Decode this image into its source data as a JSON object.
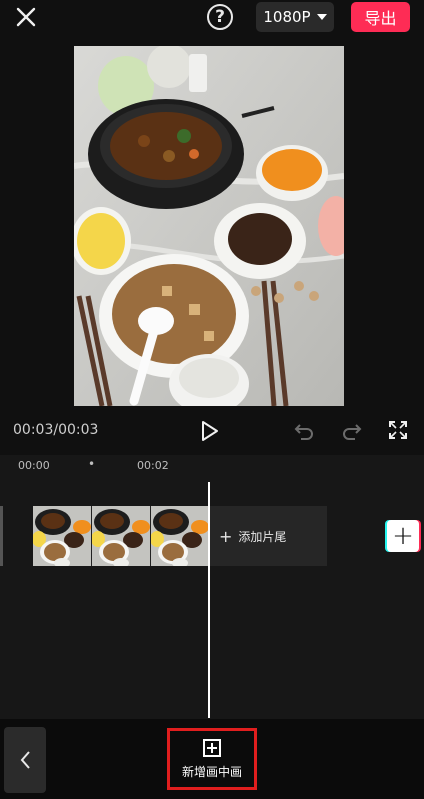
{
  "topbar": {
    "close_icon": "close-icon",
    "help_label": "?",
    "resolution": "1080P",
    "export_label": "导出"
  },
  "player": {
    "timecode": "00:03/00:03"
  },
  "timeline": {
    "ticks": [
      "00:00",
      "•",
      "00:02"
    ],
    "add_ending_label": "添加片尾",
    "add_track_label": "+"
  },
  "bottom": {
    "pip_label": "新增画中画"
  },
  "colors": {
    "accent": "#fe2c55",
    "highlight_border": "#e01e1e"
  }
}
